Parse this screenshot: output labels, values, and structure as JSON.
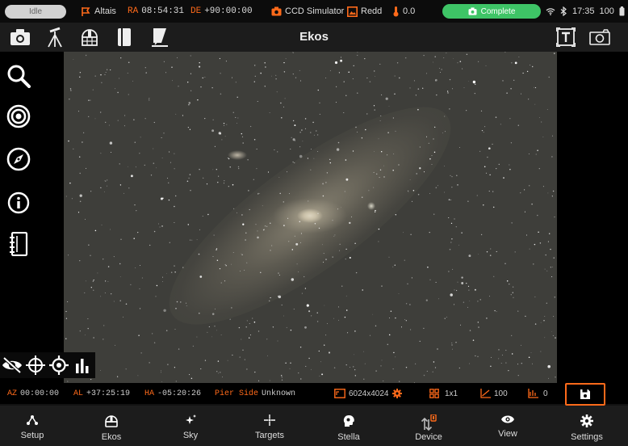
{
  "status_bar": {
    "state_label": "Idle",
    "mount_name": "Altais",
    "ra_label": "RA",
    "ra_value": "08:54:31",
    "de_label": "DE",
    "de_value": "+90:00:00",
    "camera_name": "CCD Simulator",
    "recorder_label": "Redd",
    "temperature": "0.0",
    "job_status": "Complete",
    "time": "17:35",
    "battery": "100"
  },
  "toolbar": {
    "title": "Ekos"
  },
  "info_bar": {
    "az_label": "AZ",
    "az_value": "00:00:00",
    "al_label": "AL",
    "al_value": "+37:25:19",
    "ha_label": "HA",
    "ha_value": "-05:20:26",
    "pier_label": "Pier Side",
    "pier_value": "Unknown",
    "resolution": "6024x4024",
    "binning": "1x1",
    "gain": "100",
    "offset": "0"
  },
  "bottom_nav": {
    "items": [
      {
        "label": "Setup"
      },
      {
        "label": "Ekos"
      },
      {
        "label": "Sky"
      },
      {
        "label": "Targets"
      },
      {
        "label": "Stella"
      },
      {
        "label": "Device"
      },
      {
        "label": "View"
      },
      {
        "label": "Settings"
      }
    ]
  },
  "colors": {
    "accent": "#ff6a1a",
    "complete": "#3ec466",
    "background": "#121212"
  }
}
